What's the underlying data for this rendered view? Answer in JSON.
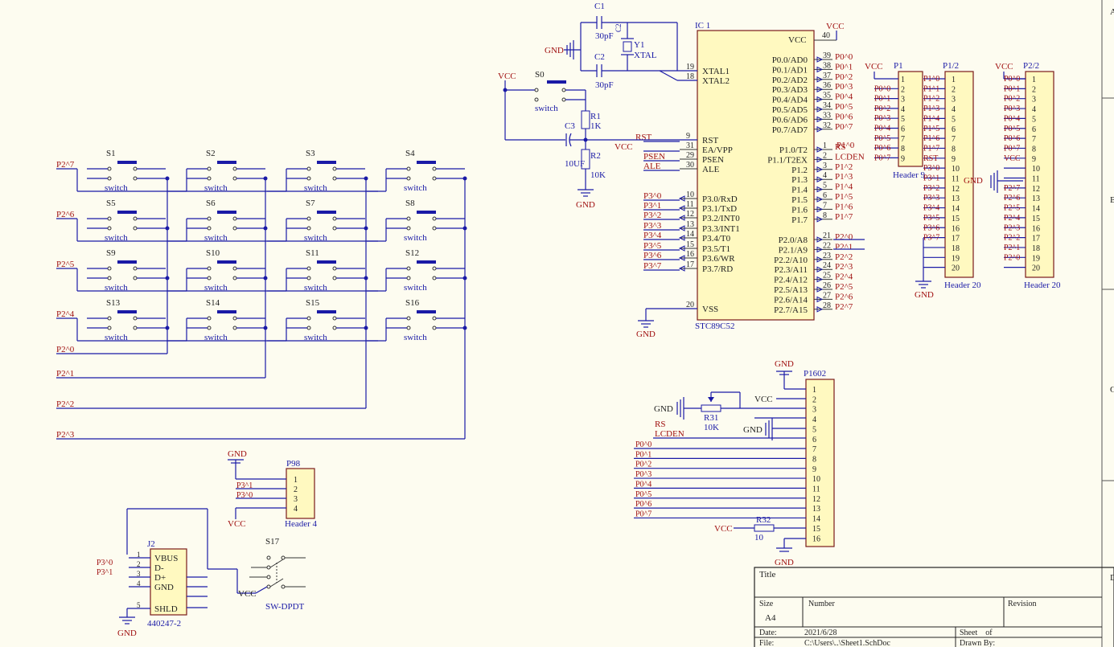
{
  "colors": {
    "background": "#fdfcf0",
    "wire": "#1a1aa6",
    "net_label": "#a01010",
    "component_fill": "#fff9c0",
    "component_border": "#7a1a1a"
  },
  "mcu": {
    "designator": "IC 1",
    "part": "STC89C52",
    "vcc_pin": "40",
    "vcc_label": "VCC",
    "left_pins": [
      {
        "num": "19",
        "name": "XTAL1",
        "net": ""
      },
      {
        "num": "18",
        "name": "XTAL2",
        "net": ""
      },
      {
        "num": "9",
        "name": "RST",
        "net": "RST"
      },
      {
        "num": "31",
        "name": "EA/VPP",
        "net": "VCC"
      },
      {
        "num": "29",
        "name": "PSEN",
        "net": "PSEN"
      },
      {
        "num": "30",
        "name": "ALE",
        "net": "ALE"
      },
      {
        "num": "10",
        "name": "P3.0/RxD",
        "net": "P3^0"
      },
      {
        "num": "11",
        "name": "P3.1/TxD",
        "net": "P3^1"
      },
      {
        "num": "12",
        "name": "P3.2/INT0",
        "net": "P3^2"
      },
      {
        "num": "13",
        "name": "P3.3/INT1",
        "net": "P3^3"
      },
      {
        "num": "14",
        "name": "P3.4/T0",
        "net": "P3^4"
      },
      {
        "num": "15",
        "name": "P3.5/T1",
        "net": "P3^5"
      },
      {
        "num": "16",
        "name": "P3.6/WR",
        "net": "P3^6"
      },
      {
        "num": "17",
        "name": "P3.7/RD",
        "net": "P3^7"
      },
      {
        "num": "20",
        "name": "VSS",
        "net": ""
      }
    ],
    "right_p0": [
      {
        "num": "39",
        "name": "P0.0/AD0",
        "net": "P0^0"
      },
      {
        "num": "38",
        "name": "P0.1/AD1",
        "net": "P0^1"
      },
      {
        "num": "37",
        "name": "P0.2/AD2",
        "net": "P0^2"
      },
      {
        "num": "36",
        "name": "P0.3/AD3",
        "net": "P0^3"
      },
      {
        "num": "35",
        "name": "P0.4/AD4",
        "net": "P0^4"
      },
      {
        "num": "34",
        "name": "P0.5/AD5",
        "net": "P0^5"
      },
      {
        "num": "33",
        "name": "P0.6/AD6",
        "net": "P0^6"
      },
      {
        "num": "32",
        "name": "P0.7/AD7",
        "net": "P0^7"
      }
    ],
    "right_p1": [
      {
        "num": "1",
        "name": "P1.0/T2",
        "net": "RS"
      },
      {
        "num": "2",
        "name": "P1.1/T2EX",
        "net": "LCDEN"
      },
      {
        "num": "3",
        "name": "P1.2",
        "net": "P1^2"
      },
      {
        "num": "4",
        "name": "P1.3",
        "net": "P1^3"
      },
      {
        "num": "5",
        "name": "P1.4",
        "net": "P1^4"
      },
      {
        "num": "6",
        "name": "P1.5",
        "net": "P1^5"
      },
      {
        "num": "7",
        "name": "P1.6",
        "net": "P1^6"
      },
      {
        "num": "8",
        "name": "P1.7",
        "net": "P1^7"
      }
    ],
    "right_p2": [
      {
        "num": "21",
        "name": "P2.0/A8",
        "net": "P2^0"
      },
      {
        "num": "22",
        "name": "P2.1/A9",
        "net": "P2^1"
      },
      {
        "num": "23",
        "name": "P2.2/A10",
        "net": "P2^2"
      },
      {
        "num": "24",
        "name": "P2.3/A11",
        "net": "P2^3"
      },
      {
        "num": "25",
        "name": "P2.4/A12",
        "net": "P2^4"
      },
      {
        "num": "26",
        "name": "P2.5/A13",
        "net": "P2^5"
      },
      {
        "num": "27",
        "name": "P2.6/A14",
        "net": "P2^6"
      },
      {
        "num": "28",
        "name": "P2.7/A15",
        "net": "P2^7"
      }
    ],
    "p1_overlap_label": "P1^0"
  },
  "crystal": {
    "c1": "C1",
    "c1_value": "30pF",
    "c2": "C2",
    "c2_value": "30pF",
    "y1": "Y1",
    "y1_value": "XTAL",
    "gnd": "GND",
    "y1_pin_label": "C2"
  },
  "reset": {
    "vcc": "VCC",
    "s0": "S0",
    "s0_value": "switch",
    "r1": "R1",
    "r1_value": "1K",
    "c3": "C3",
    "c3_value": "10UF",
    "r2": "R2",
    "r2_value": "10K",
    "gnd": "GND"
  },
  "keypad": {
    "row_nets": [
      "P2^7",
      "P2^6",
      "P2^5",
      "P2^4"
    ],
    "col_nets": [
      "P2^0",
      "P2^1",
      "P2^2",
      "P2^3"
    ],
    "switches": [
      "S1",
      "S2",
      "S3",
      "S4",
      "S5",
      "S6",
      "S7",
      "S8",
      "S9",
      "S10",
      "S11",
      "S12",
      "S13",
      "S14",
      "S15",
      "S16"
    ],
    "switch_value": "switch"
  },
  "p1": {
    "designator": "P1",
    "vcc": "VCC",
    "pins": [
      "1",
      "2",
      "3",
      "4",
      "5",
      "6",
      "7",
      "8",
      "9"
    ],
    "nets": [
      "P0^0",
      "P0^1",
      "P0^2",
      "P0^3",
      "P0^4",
      "P0^5",
      "P0^6",
      "P0^7"
    ],
    "value": "Header 9"
  },
  "p1_2": {
    "designator": "P1/2",
    "pins": [
      "1",
      "2",
      "3",
      "4",
      "5",
      "6",
      "7",
      "8",
      "9",
      "10",
      "11",
      "12",
      "13",
      "14",
      "15",
      "16",
      "17",
      "18",
      "19",
      "20"
    ],
    "nets": [
      "P1^0",
      "P1^1",
      "P1^2",
      "P1^3",
      "P1^4",
      "P1^5",
      "P1^6",
      "P1^7",
      "RST",
      "P3^0",
      "P3^1",
      "P3^2",
      "P3^3",
      "P3^4",
      "P3^5",
      "P3^6",
      "P3^7"
    ],
    "gnd": "GND",
    "value": "Header 20",
    "right_gnd": "GND"
  },
  "p2_2": {
    "designator": "P2/2",
    "vcc": "VCC",
    "pins": [
      "1",
      "2",
      "3",
      "4",
      "5",
      "6",
      "7",
      "8",
      "9",
      "10",
      "11",
      "12",
      "13",
      "14",
      "15",
      "16",
      "17",
      "18",
      "19",
      "20"
    ],
    "nets": [
      "P0^0",
      "P0^1",
      "P0^2",
      "P0^3",
      "P0^4",
      "P0^5",
      "P0^6",
      "P0^7",
      "VCC",
      "",
      "",
      "P2^7",
      "P2^6",
      "P2^5",
      "P2^4",
      "P2^3",
      "P2^2",
      "P2^1",
      "P2^0"
    ],
    "value": "Header 20"
  },
  "lcd": {
    "designator": "P1602",
    "gnd_top": "GND",
    "pins": [
      "1",
      "2",
      "3",
      "4",
      "5",
      "6",
      "7",
      "8",
      "9",
      "10",
      "11",
      "12",
      "13",
      "14",
      "15",
      "16"
    ],
    "vcc": "VCC",
    "gnd_left": "GND",
    "gnd_mid": "GND",
    "r31": "R31",
    "r31_value": "10K",
    "rs": "RS",
    "lcden": "LCDEN",
    "data_nets": [
      "P0^0",
      "P0^1",
      "P0^2",
      "P0^3",
      "P0^4",
      "P0^5",
      "P0^6",
      "P0^7"
    ],
    "vcc_bl": "VCC",
    "r32": "R32",
    "r32_value": "10",
    "gnd_bottom": "GND"
  },
  "p98": {
    "designator": "P98",
    "gnd": "GND",
    "pins": [
      "1",
      "2",
      "3",
      "4"
    ],
    "nets": [
      "P3^1",
      "P3^0"
    ],
    "vcc": "VCC",
    "value": "Header 4"
  },
  "usb": {
    "designator": "J2",
    "pins": [
      "VBUS",
      "D-",
      "D+",
      "GND",
      "SHLD"
    ],
    "pin_nums": [
      "1",
      "2",
      "3",
      "4",
      "5"
    ],
    "nets": [
      "P3^0",
      "P3^1"
    ],
    "value": "440247-2",
    "gnd": "GND"
  },
  "sw17": {
    "designator": "S17",
    "vcc": "VCC",
    "value": "SW-DPDT"
  },
  "title_block": {
    "title": "Title",
    "size": "Size",
    "size_value": "A4",
    "number": "Number",
    "revision": "Revision",
    "date_label": "Date:",
    "date": "2021/6/28",
    "sheet": "Sheet    of",
    "file_label": "File:",
    "file": "C:\\Users\\..\\Sheet1.SchDoc",
    "drawn_by": "Drawn By:"
  },
  "border_zones": [
    "A",
    "B",
    "C",
    "D"
  ]
}
